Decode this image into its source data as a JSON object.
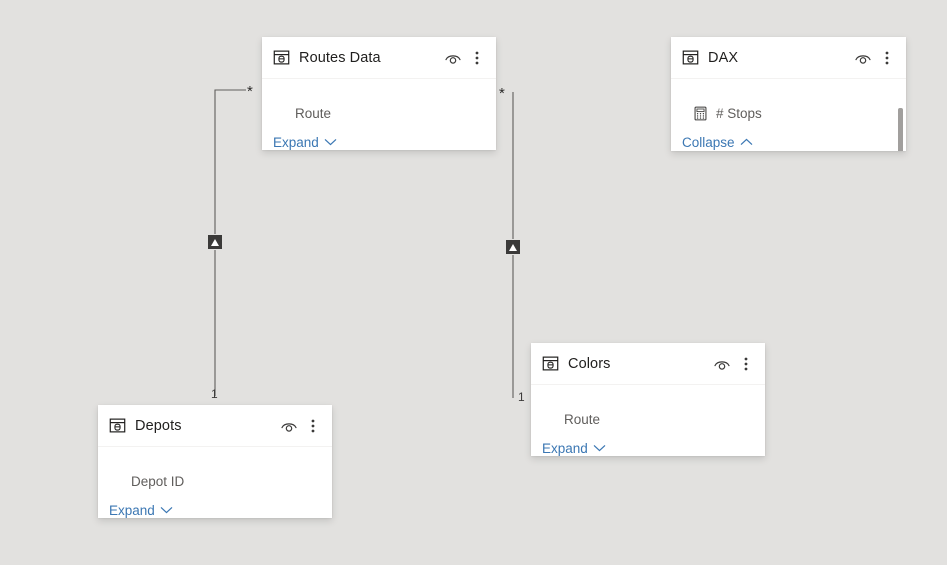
{
  "canvas": {
    "background": "#e2e1df",
    "accent_link_color": "#3b77b3",
    "line_color": "#605e5c",
    "marker_color": "#3b3a39"
  },
  "tables": [
    {
      "id": "routes-data",
      "name": "Routes Data",
      "table_icon": "table-icon",
      "hide_icon": "eye-icon",
      "more_icon": "more-vertical-icon",
      "fields": [
        {
          "name": "Route",
          "icon": "column-icon",
          "indented": true
        }
      ],
      "expander": {
        "label": "Expand",
        "icon": "chevron-down-icon"
      },
      "has_scrollbar": false
    },
    {
      "id": "dax",
      "name": "DAX",
      "table_icon": "table-icon",
      "hide_icon": "eye-icon",
      "more_icon": "more-vertical-icon",
      "fields": [
        {
          "name": "# Stops",
          "icon": "calculator-icon",
          "indented": false
        }
      ],
      "expander": {
        "label": "Collapse",
        "icon": "chevron-up-icon"
      },
      "has_scrollbar": true
    },
    {
      "id": "colors",
      "name": "Colors",
      "table_icon": "table-icon",
      "hide_icon": "eye-icon",
      "more_icon": "more-vertical-icon",
      "fields": [
        {
          "name": "Route",
          "icon": "column-icon",
          "indented": true
        }
      ],
      "expander": {
        "label": "Expand",
        "icon": "chevron-down-icon"
      },
      "has_scrollbar": false
    },
    {
      "id": "depots",
      "name": "Depots",
      "table_icon": "table-icon",
      "hide_icon": "eye-icon",
      "more_icon": "more-vertical-icon",
      "fields": [
        {
          "name": "Depot ID",
          "icon": "column-icon",
          "indented": true
        }
      ],
      "expander": {
        "label": "Expand",
        "icon": "chevron-down-icon"
      },
      "has_scrollbar": false
    }
  ],
  "relationships": [
    {
      "id": "routes-depots",
      "from_table": "Routes Data",
      "to_table": "Depots",
      "many_label": "*",
      "one_label": "1",
      "filter_direction_icon": "filter-arrow-up-icon"
    },
    {
      "id": "colors-dax",
      "from_table": "DAX",
      "to_table": "Colors",
      "many_label": "*",
      "one_label": "1",
      "filter_direction_icon": "filter-arrow-up-icon"
    }
  ]
}
